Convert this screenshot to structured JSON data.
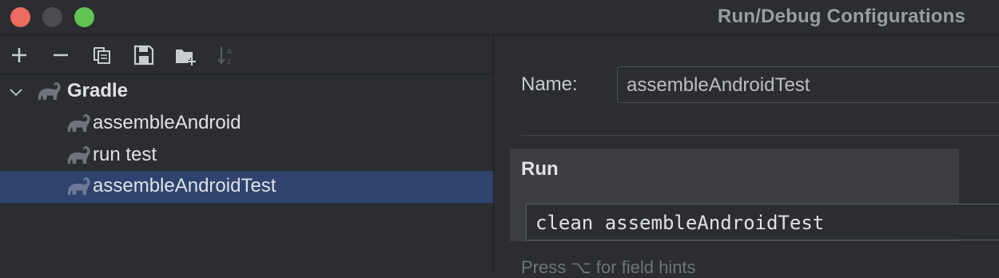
{
  "window": {
    "title": "Run/Debug Configurations",
    "buttons": [
      "close",
      "minimize",
      "maximize"
    ]
  },
  "toolbar": {
    "icons": [
      "add-icon",
      "remove-icon",
      "copy-icon",
      "save-icon",
      "new-folder-icon",
      "sort-alphabetically-icon"
    ]
  },
  "tree": {
    "group_label": "Gradle",
    "items": [
      {
        "label": "assembleAndroid",
        "icon": "gradle-elephant-icon"
      },
      {
        "label": "run test",
        "icon": "gradle-elephant-icon"
      },
      {
        "label": "assembleAndroidTest",
        "icon": "gradle-elephant-icon",
        "selected": true
      }
    ]
  },
  "config": {
    "name_label": "Name:",
    "name_value": "assembleAndroidTest",
    "run_section_title": "Run",
    "run_command": "clean assembleAndroidTest",
    "hint": "Press ⌥ for field hints"
  },
  "colors": {
    "background": "#2b2d30",
    "selection": "#2e436e",
    "section_background": "#3c3e42",
    "close": "#ed6a5e",
    "maximize": "#61c554"
  }
}
